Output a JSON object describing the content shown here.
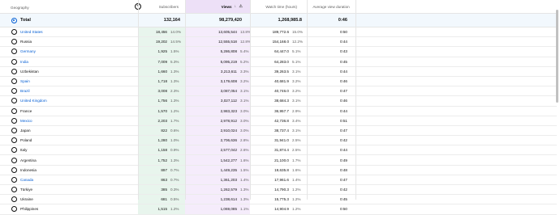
{
  "header": {
    "geography": "Geography",
    "subscribers": "Subscribers",
    "views": "Views",
    "watch_time": "Watch time (hours)",
    "avg_view_duration": "Average view duration",
    "sort_icons": "↓ ⚠"
  },
  "total": {
    "label": "Total",
    "subscribers": "132,164",
    "views": "98,279,420",
    "watch_time": "1,268,985.8",
    "avg_view_duration": "0:46"
  },
  "rows": [
    {
      "country": "United States",
      "link": true,
      "subs": "18,456",
      "subs_pct": "14.0%",
      "views": "13,605,544",
      "views_pct": "13.8%",
      "watch": "189,772.6",
      "watch_pct": "15.0%",
      "avg": "0:50"
    },
    {
      "country": "Russia",
      "link": false,
      "subs": "19,202",
      "subs_pct": "14.5%",
      "views": "12,555,518",
      "views_pct": "12.8%",
      "watch": "154,168.0",
      "watch_pct": "12.2%",
      "avg": "0:44"
    },
    {
      "country": "Germany",
      "link": true,
      "subs": "1,925",
      "subs_pct": "1.5%",
      "views": "5,286,808",
      "views_pct": "5.4%",
      "watch": "64,447.0",
      "watch_pct": "5.1%",
      "avg": "0:43"
    },
    {
      "country": "India",
      "link": true,
      "subs": "7,009",
      "subs_pct": "5.3%",
      "views": "5,095,219",
      "views_pct": "5.2%",
      "watch": "64,283.0",
      "watch_pct": "5.1%",
      "avg": "0:45"
    },
    {
      "country": "Uzbekistan",
      "link": false,
      "subs": "1,660",
      "subs_pct": "1.3%",
      "views": "3,213,611",
      "views_pct": "3.3%",
      "watch": "39,263.5",
      "watch_pct": "3.1%",
      "avg": "0:44"
    },
    {
      "country": "Spain",
      "link": true,
      "subs": "1,718",
      "subs_pct": "1.3%",
      "views": "3,179,608",
      "views_pct": "3.2%",
      "watch": "40,681.9",
      "watch_pct": "3.2%",
      "avg": "0:46"
    },
    {
      "country": "Brazil",
      "link": true,
      "subs": "3,008",
      "subs_pct": "2.3%",
      "views": "3,087,054",
      "views_pct": "3.1%",
      "watch": "40,746.0",
      "watch_pct": "3.2%",
      "avg": "0:47"
    },
    {
      "country": "United Kingdom",
      "link": true,
      "subs": "1,756",
      "subs_pct": "1.3%",
      "views": "3,027,112",
      "views_pct": "3.1%",
      "watch": "38,684.3",
      "watch_pct": "3.1%",
      "avg": "0:46"
    },
    {
      "country": "France",
      "link": false,
      "subs": "1,570",
      "subs_pct": "1.2%",
      "views": "2,983,323",
      "views_pct": "3.0%",
      "watch": "36,957.7",
      "watch_pct": "2.9%",
      "avg": "0:44"
    },
    {
      "country": "Mexico",
      "link": true,
      "subs": "2,203",
      "subs_pct": "1.7%",
      "views": "2,978,912",
      "views_pct": "3.0%",
      "watch": "42,736.8",
      "watch_pct": "3.4%",
      "avg": "0:51"
    },
    {
      "country": "Japan",
      "link": false,
      "subs": "822",
      "subs_pct": "0.6%",
      "views": "2,910,024",
      "views_pct": "3.0%",
      "watch": "38,737.4",
      "watch_pct": "3.1%",
      "avg": "0:47"
    },
    {
      "country": "Poland",
      "link": false,
      "subs": "1,280",
      "subs_pct": "1.0%",
      "views": "2,706,636",
      "views_pct": "2.8%",
      "watch": "31,941.0",
      "watch_pct": "2.5%",
      "avg": "0:42"
    },
    {
      "country": "Italy",
      "link": false,
      "subs": "1,158",
      "subs_pct": "0.9%",
      "views": "2,577,042",
      "views_pct": "2.6%",
      "watch": "31,874.4",
      "watch_pct": "2.5%",
      "avg": "0:44"
    },
    {
      "country": "Argentina",
      "link": false,
      "subs": "1,752",
      "subs_pct": "1.3%",
      "views": "1,542,277",
      "views_pct": "1.6%",
      "watch": "21,100.0",
      "watch_pct": "1.7%",
      "avg": "0:49"
    },
    {
      "country": "Indonesia",
      "link": false,
      "subs": "897",
      "subs_pct": "0.7%",
      "views": "1,449,235",
      "views_pct": "1.5%",
      "watch": "19,635.8",
      "watch_pct": "1.6%",
      "avg": "0:48"
    },
    {
      "country": "Canada",
      "link": true,
      "subs": "863",
      "subs_pct": "0.7%",
      "views": "1,361,203",
      "views_pct": "1.4%",
      "watch": "17,961.6",
      "watch_pct": "1.4%",
      "avg": "0:47"
    },
    {
      "country": "Türkiye",
      "link": false,
      "subs": "385",
      "subs_pct": "0.3%",
      "views": "1,262,579",
      "views_pct": "1.3%",
      "watch": "14,790.3",
      "watch_pct": "1.2%",
      "avg": "0:42"
    },
    {
      "country": "Ukraine",
      "link": false,
      "subs": "681",
      "subs_pct": "0.5%",
      "views": "1,238,614",
      "views_pct": "1.3%",
      "watch": "15,775.3",
      "watch_pct": "1.2%",
      "avg": "0:45"
    },
    {
      "country": "Philippines",
      "link": false,
      "subs": "1,515",
      "subs_pct": "1.2%",
      "views": "1,069,085",
      "views_pct": "1.1%",
      "watch": "14,904.9",
      "watch_pct": "1.2%",
      "avg": "0:50"
    }
  ],
  "colors": {
    "link": "#065fd4",
    "subs_column_bg": "#e8f5ed",
    "views_column_bg": "#f5ecfb",
    "views_header_bg": "#ede0f7",
    "total_row_bg": "#f2f8fd"
  },
  "icons": {
    "add_metric": "plus-circle-icon",
    "sort": "arrow-down-icon",
    "warning": "warning-icon",
    "radio": "radio-button-icon"
  }
}
